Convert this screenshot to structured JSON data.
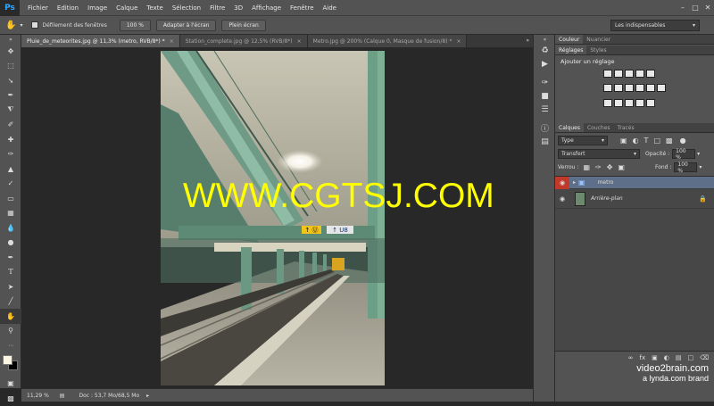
{
  "app": {
    "logo": "Ps"
  },
  "menu": [
    "Fichier",
    "Edition",
    "Image",
    "Calque",
    "Texte",
    "Sélection",
    "Filtre",
    "3D",
    "Affichage",
    "Fenêtre",
    "Aide"
  ],
  "options": {
    "scroll_all_label": "Défilement des fenêtres",
    "zoom_btn": "100 %",
    "fit_btn": "Adapter à l'écran",
    "fill_btn": "Plein écran",
    "workspace": "Les indispensables"
  },
  "tabs": [
    {
      "label": "Pluie_de_meteorites.jpg @ 11,3% (metro, RVB/8*) *",
      "active": true
    },
    {
      "label": "Station_complete.jpg @ 12,5% (RVB/8*)",
      "active": false
    },
    {
      "label": "Metro.jpg @ 200% (Calque 0, Masque de fusion/8) *",
      "active": false
    }
  ],
  "canvas": {
    "watermark": "WWW.CGTSJ.COM",
    "sign_left": "↑ Ⓤ",
    "sign_right": "↑ U8"
  },
  "status": {
    "zoom": "11,29 %",
    "doc": "Doc : 53,7 Mo/68,5 Mo"
  },
  "panels": {
    "color_tabs": [
      "Couleur",
      "Nuancier"
    ],
    "adj_tabs": [
      "Réglages",
      "Styles"
    ],
    "adj_title": "Ajouter un réglage",
    "layer_tabs": [
      "Calques",
      "Couches",
      "Tracés"
    ],
    "kind": "Type",
    "blend": "Transfert",
    "opacity_label": "Opacité :",
    "opacity": "100 %",
    "lock_label": "Verrou :",
    "fill_label": "Fond :",
    "fill": "100 %",
    "layers": [
      {
        "name": "metro",
        "type": "group",
        "selected": true
      },
      {
        "name": "Arrière-plan",
        "type": "image",
        "selected": false
      }
    ]
  },
  "brand": {
    "line1": "video2brain.com",
    "line2": "a lynda.com brand"
  },
  "colors": {
    "accent": "#31a8ff",
    "watermark": "#ffff00",
    "selected_layer": "#5e6f8a"
  }
}
